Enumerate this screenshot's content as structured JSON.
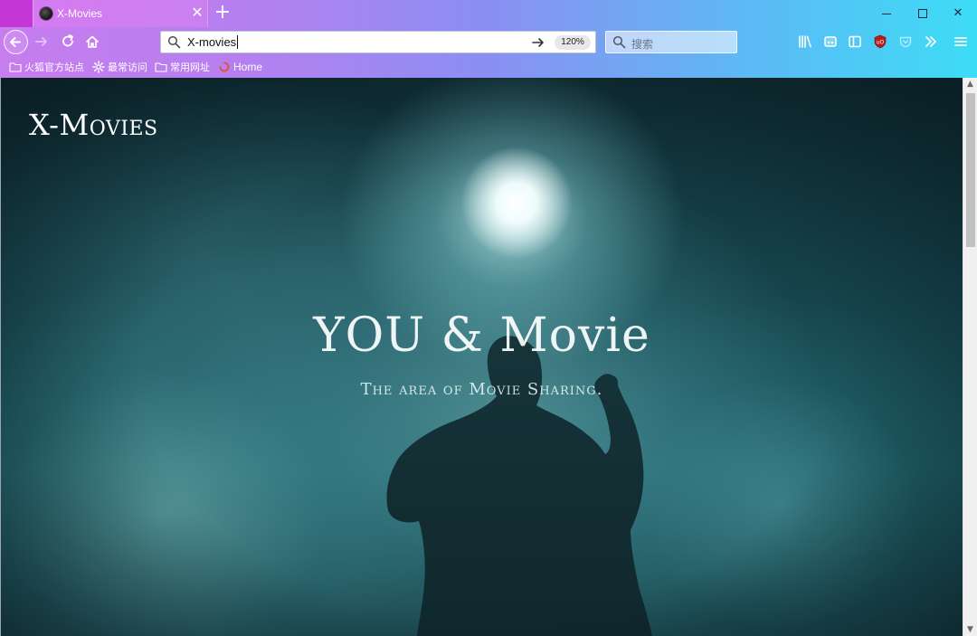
{
  "window": {
    "tab_title": "X-Movies",
    "tab_close": "✕",
    "new_tab": "+",
    "controls": {
      "minimize": "minimize",
      "maximize": "maximize",
      "close": "✕"
    }
  },
  "navbar": {
    "url_value": "X-movies",
    "zoom": "120%",
    "search_placeholder": "搜索"
  },
  "bookmarks": [
    {
      "label": "火狐官方站点",
      "icon": "folder-icon"
    },
    {
      "label": "最常访问",
      "icon": "gear-icon"
    },
    {
      "label": "常用网址",
      "icon": "folder-icon"
    },
    {
      "label": "Home",
      "icon": "home-favicon"
    }
  ],
  "page": {
    "logo": "X-Movies",
    "hero_title": "YOU & Movie",
    "hero_subtitle": "The area of Movie Sharing."
  },
  "scrollbar": {
    "up": "▲",
    "down": "▼"
  },
  "colors": {
    "chrome_gradient_start": "#c77dee",
    "chrome_gradient_end": "#3ddcf6",
    "hero_teal": "#1d5a62",
    "ublock_red": "#b81c1c"
  }
}
